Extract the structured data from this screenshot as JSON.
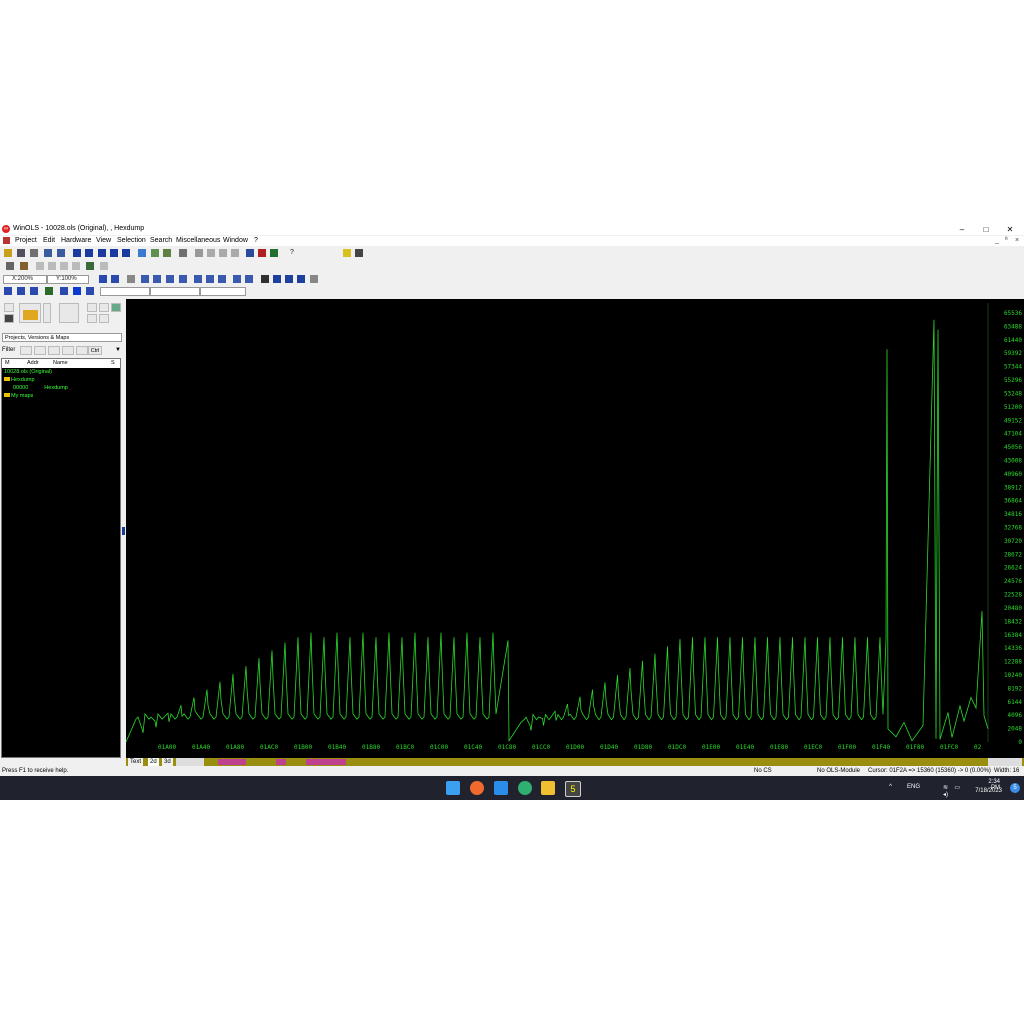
{
  "window": {
    "title": "WinOLS - 10028.ols (Original), , Hexdump",
    "app_icon": "winols-logo-icon",
    "controls": [
      "–",
      "□",
      "✕"
    ]
  },
  "menu": [
    "Project",
    "Edit",
    "Hardware",
    "View",
    "Selection",
    "Search",
    "Miscellaneous",
    "Window",
    "?"
  ],
  "toolbar": {
    "x_zoom": "X:200%",
    "y_zoom": "Y:100%",
    "chk_label": "Chk",
    "help_mark": "?"
  },
  "left_panel": {
    "project_selector": "Projects, Versions & Maps",
    "filter_label": "Filter",
    "filter_ctrl": "Ctrl",
    "tree_columns": [
      "M",
      "Addr",
      "Name",
      "S"
    ],
    "tree": [
      {
        "text": "10028.ols (Original)",
        "indent": 0
      },
      {
        "text": "Hexdump",
        "indent": 1,
        "folder": true
      },
      {
        "text": "00000",
        "indent": 2,
        "extra": "Hexdump"
      },
      {
        "text": "My maps",
        "indent": 1,
        "folder": true
      }
    ]
  },
  "graph": {
    "line_color": "#2bd92b",
    "background": "#000000",
    "y_labels": [
      "65536",
      "63488",
      "61440",
      "59392",
      "57344",
      "55296",
      "53248",
      "51200",
      "49152",
      "47104",
      "45056",
      "43008",
      "40960",
      "38912",
      "36864",
      "34816",
      "32768",
      "30720",
      "28672",
      "26624",
      "24576",
      "22528",
      "20480",
      "18432",
      "16384",
      "14336",
      "12288",
      "10240",
      "8192",
      "6144",
      "4096",
      "2048",
      "0"
    ],
    "x_labels": [
      "01A00",
      "01A40",
      "01A80",
      "01AC0",
      "01B00",
      "01B40",
      "01B80",
      "01BC0",
      "01C00",
      "01C40",
      "01C80",
      "01CC0",
      "01D00",
      "01D40",
      "01D80",
      "01DC0",
      "01E00",
      "01E40",
      "01E80",
      "01EC0",
      "01F00",
      "01F40",
      "01F80",
      "01FC0",
      "02"
    ]
  },
  "tabs": [
    "Text",
    "2d",
    "3d"
  ],
  "status": {
    "help": "Press F1 to receive help.",
    "cs": "No CS",
    "module": "No OLS-Module",
    "cursor": "Cursor: 01F2A => 15360 (15360) -> 0 (0.00%)",
    "width": "Width: 16"
  },
  "taskbar": {
    "time": "2:34 PM",
    "date": "7/18/2023",
    "lang": "ENG",
    "notification_count": "5",
    "icons": [
      "windows-start-icon",
      "search-icon",
      "file-explorer-icon",
      "mail-icon",
      "edge-icon",
      "folder-icon",
      "winols-taskbar-icon"
    ]
  }
}
